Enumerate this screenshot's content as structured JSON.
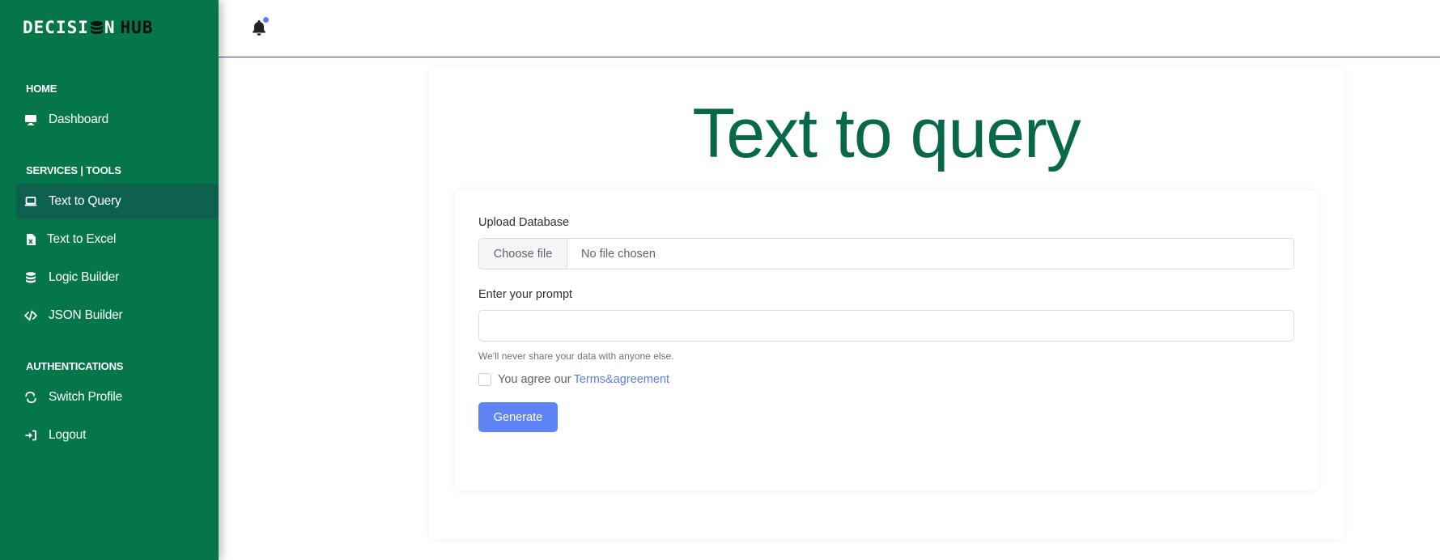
{
  "brand": {
    "word1": "DECISI",
    "word1_end": "N",
    "word2": "HUB"
  },
  "sidebar": {
    "sections": [
      {
        "title": "HOME"
      },
      {
        "title": "SERVICES | TOOLS"
      },
      {
        "title": "AUTHENTICATIONS"
      }
    ],
    "items": [
      {
        "label": "Dashboard",
        "icon": "monitor-icon"
      },
      {
        "label": "Text to Query",
        "icon": "laptop-icon",
        "active": true
      },
      {
        "label": "Text to Excel",
        "icon": "excel-file-icon"
      },
      {
        "label": "Logic Builder",
        "icon": "database-icon"
      },
      {
        "label": "JSON Builder",
        "icon": "code-icon"
      },
      {
        "label": "Switch Profile",
        "icon": "switch-arrows-icon"
      },
      {
        "label": "Logout",
        "icon": "sign-in-icon"
      }
    ]
  },
  "topbar": {
    "notification_icon": "bell-icon"
  },
  "main": {
    "title": "Text to query",
    "upload_label": "Upload Database",
    "file_button": "Choose file",
    "file_status": "No file chosen",
    "prompt_label": "Enter your prompt",
    "prompt_value": "",
    "help_text": "We'll never share your data with anyone else.",
    "agree_text": "You agree our",
    "agree_link": "Terms&agreement",
    "generate_button": "Generate"
  },
  "colors": {
    "sidebar_bg": "#04764a",
    "active_item_bg": "#0d5f4e",
    "title_green": "#07684a",
    "accent_blue": "#5e84f5"
  }
}
